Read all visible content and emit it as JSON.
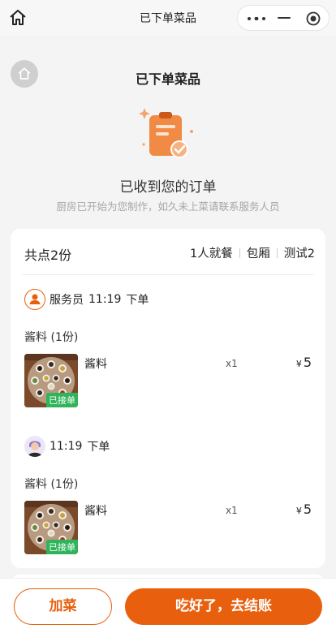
{
  "window": {
    "title": "已下单菜品"
  },
  "page": {
    "title": "已下单菜品"
  },
  "status": {
    "title": "已收到您的订单",
    "hint": "厨房已开始为您制作，如久未上菜请联系服务人员"
  },
  "summary": {
    "total": "共点2份",
    "tags": [
      "1人就餐",
      "包厢",
      "测试2"
    ]
  },
  "orders": [
    {
      "by": "服务员",
      "time": "11:19",
      "action": "下单",
      "section": "酱料 (1份)",
      "dish": {
        "name": "酱料",
        "qty": "x1",
        "currency": "¥",
        "price": "5",
        "status": "已接单"
      }
    },
    {
      "by": "",
      "time": "11:19",
      "action": "下单",
      "section": "酱料 (1份)",
      "dish": {
        "name": "酱料",
        "qty": "x1",
        "currency": "¥",
        "price": "5",
        "status": "已接单"
      }
    }
  ],
  "actions": {
    "add": "加菜",
    "checkout": "吃好了，去结账"
  },
  "icons": [
    "home-icon",
    "more-icon",
    "minus-icon",
    "target-icon",
    "clipboard-icon",
    "staff-icon",
    "user-avatar"
  ],
  "colors": {
    "accent": "#e8600e",
    "badge": "#2fb45a",
    "background": "#f4f4f4"
  }
}
